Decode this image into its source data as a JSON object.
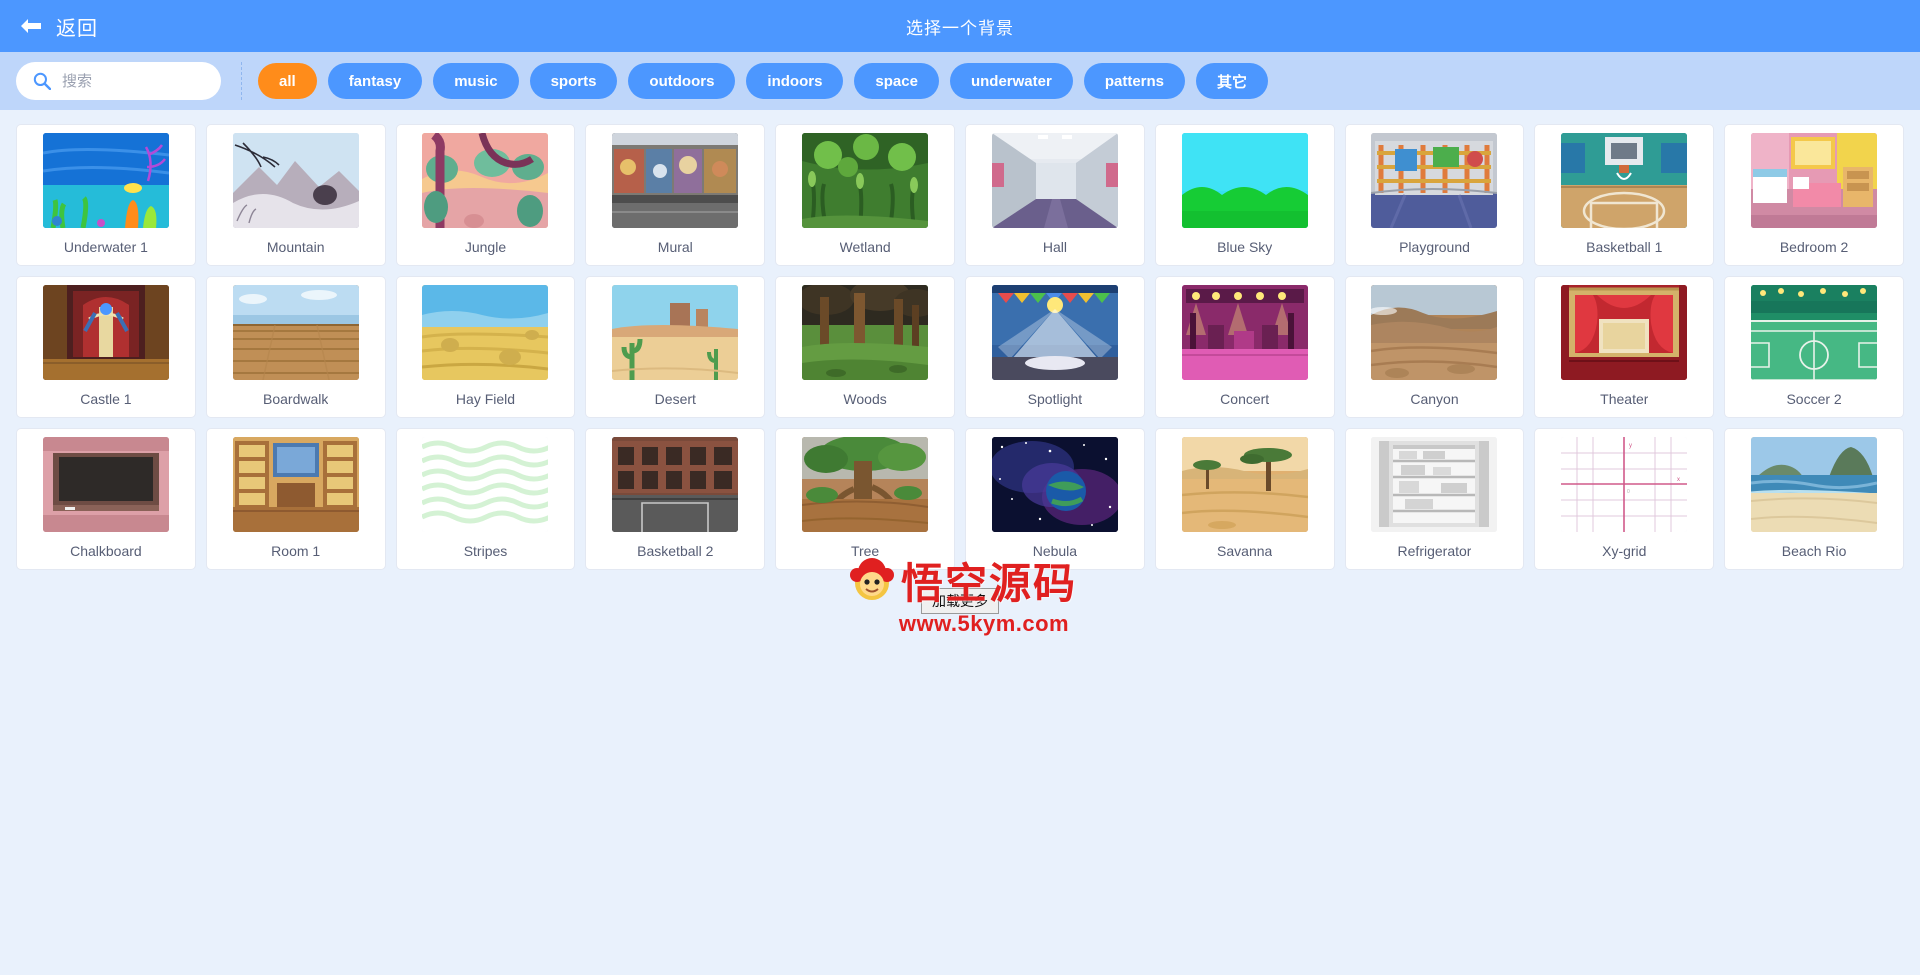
{
  "header": {
    "back_label": "返回",
    "title": "选择一个背景",
    "back_icon": "arrow-left-icon",
    "bg_color": "#4c97ff"
  },
  "search": {
    "placeholder": "搜索",
    "value": "",
    "icon": "search-icon"
  },
  "filters": {
    "active": "all",
    "tags": [
      {
        "label": "all",
        "active": true
      },
      {
        "label": "fantasy",
        "active": false
      },
      {
        "label": "music",
        "active": false
      },
      {
        "label": "sports",
        "active": false
      },
      {
        "label": "outdoors",
        "active": false
      },
      {
        "label": "indoors",
        "active": false
      },
      {
        "label": "space",
        "active": false
      },
      {
        "label": "underwater",
        "active": false
      },
      {
        "label": "patterns",
        "active": false
      },
      {
        "label": "其它",
        "active": false
      }
    ],
    "active_color": "#ff8c1a",
    "tag_color": "#4c97ff"
  },
  "backdrops": [
    {
      "label": "Underwater 1",
      "thumb": "underwater-1"
    },
    {
      "label": "Mountain",
      "thumb": "mountain"
    },
    {
      "label": "Jungle",
      "thumb": "jungle"
    },
    {
      "label": "Mural",
      "thumb": "mural"
    },
    {
      "label": "Wetland",
      "thumb": "wetland"
    },
    {
      "label": "Hall",
      "thumb": "hall"
    },
    {
      "label": "Blue Sky",
      "thumb": "blue-sky"
    },
    {
      "label": "Playground",
      "thumb": "playground"
    },
    {
      "label": "Basketball 1",
      "thumb": "basketball-1"
    },
    {
      "label": "Bedroom 2",
      "thumb": "bedroom-2"
    },
    {
      "label": "Castle 1",
      "thumb": "castle-1"
    },
    {
      "label": "Boardwalk",
      "thumb": "boardwalk"
    },
    {
      "label": "Hay Field",
      "thumb": "hay-field"
    },
    {
      "label": "Desert",
      "thumb": "desert"
    },
    {
      "label": "Woods",
      "thumb": "woods"
    },
    {
      "label": "Spotlight",
      "thumb": "spotlight"
    },
    {
      "label": "Concert",
      "thumb": "concert"
    },
    {
      "label": "Canyon",
      "thumb": "canyon"
    },
    {
      "label": "Theater",
      "thumb": "theater"
    },
    {
      "label": "Soccer 2",
      "thumb": "soccer-2"
    },
    {
      "label": "Chalkboard",
      "thumb": "chalkboard"
    },
    {
      "label": "Room 1",
      "thumb": "room-1"
    },
    {
      "label": "Stripes",
      "thumb": "stripes"
    },
    {
      "label": "Basketball 2",
      "thumb": "basketball-2"
    },
    {
      "label": "Tree",
      "thumb": "tree"
    },
    {
      "label": "Nebula",
      "thumb": "nebula"
    },
    {
      "label": "Savanna",
      "thumb": "savanna"
    },
    {
      "label": "Refrigerator",
      "thumb": "refrigerator"
    },
    {
      "label": "Xy-grid",
      "thumb": "xy-grid"
    },
    {
      "label": "Beach Rio",
      "thumb": "beach-rio"
    }
  ],
  "load_more": {
    "label": "加载更多"
  },
  "watermark": {
    "title": "悟空源码",
    "url": "www.5kym.com",
    "color": "#e02020"
  }
}
